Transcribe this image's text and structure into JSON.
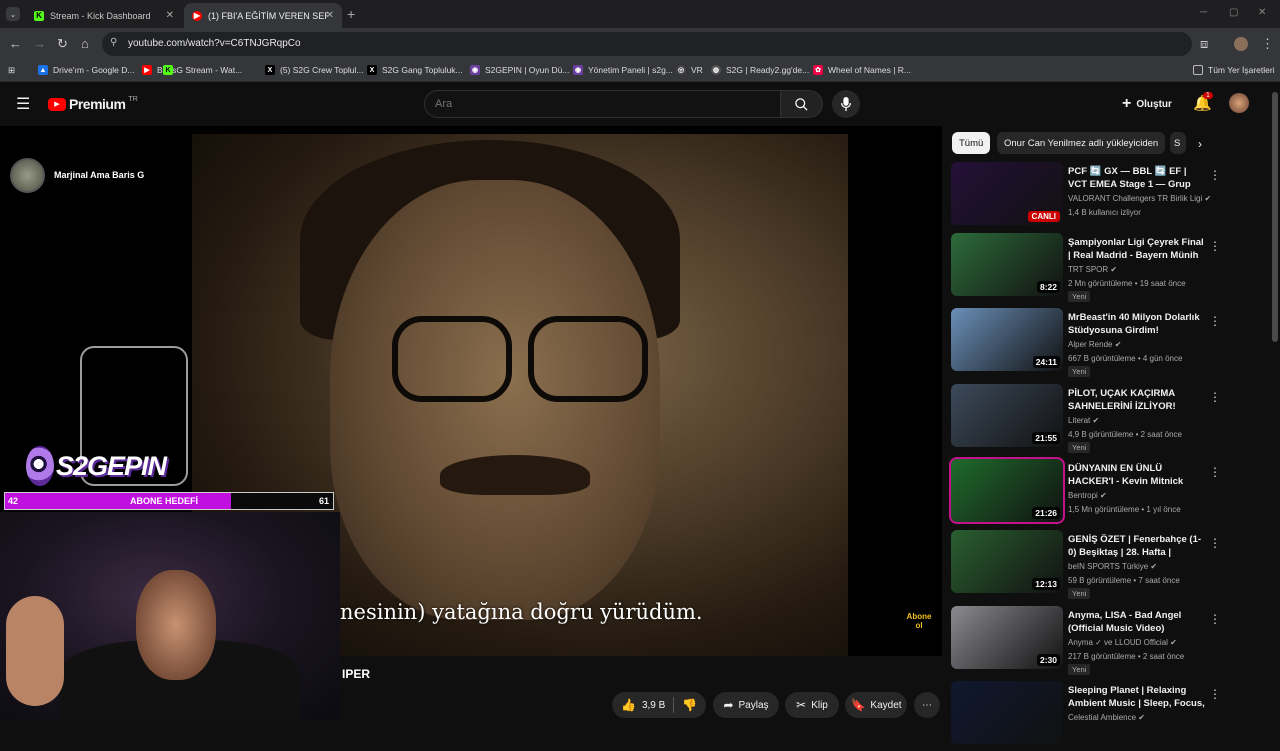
{
  "browser": {
    "tabs": [
      {
        "title": "Stream - Kick Dashboard",
        "icon": "kick-icon"
      },
      {
        "title": "(1) FBI'A EĞİTİM VEREN SERİ K…",
        "icon": "youtube-icon"
      }
    ],
    "url": "youtube.com/watch?v=C6TNJGRqpCo",
    "bookmarks": [
      "Drive'ım - Google D...",
      "BarisG Stream - Wat...",
      "(5) S2G Crew Toplul...",
      "S2G Gang Topluluk...",
      "S2GEPIN | Oyun Dü...",
      "Yönetim Paneli | s2g...",
      "VR",
      "S2G | Ready2.gg'de...",
      "Wheel of Names | R..."
    ],
    "all_bookmarks": "Tüm Yer İşaretleri"
  },
  "youtube": {
    "logo_text": "Premium",
    "logo_sup": "TR",
    "search_placeholder": "Ara",
    "create_label": "Oluştur",
    "notif_count": "1"
  },
  "overlay": {
    "channel_name": "Marjinal Ama Baris G",
    "logo_text": "S2GEPIN",
    "goal_current": "42",
    "goal_title": "ABONE HEDEFİ",
    "goal_target": "61",
    "goal_progress": 0.69
  },
  "video": {
    "subtitle": "nesinin) yatağına doğru yürüdüm.",
    "title_fragment": "IPER",
    "badge": "Abone ol",
    "actions": {
      "likes": "3,9 B",
      "share": "Paylaş",
      "clip": "Klip",
      "save": "Kaydet"
    }
  },
  "chips": [
    "Tümü",
    "Onur Can Yenilmez adlı yükleyiciden",
    "S"
  ],
  "recommendations": [
    {
      "title": "PCF 🔄 GX — BBL 🔄 EF | VCT EMEA Stage 1 — Grup Aşaması",
      "channel": "VALORANT Challengers TR Birlik Ligi",
      "meta": "1,4 B kullanıcı izliyor",
      "badge": "CANLI",
      "thumb_color": "#241038"
    },
    {
      "title": "Şampiyonlar Ligi Çeyrek Final | Real Madrid - Bayern Münih ...",
      "channel": "TRT SPOR",
      "meta": "2 Mn görüntüleme • 19 saat önce",
      "duration": "8:22",
      "tag": "Yeni",
      "thumb_color": "#2d6b3a"
    },
    {
      "title": "MrBeast'in 40 Milyon Dolarlık Stüdyosuna Girdim!",
      "channel": "Alper Rende",
      "meta": "667 B görüntüleme • 4 gün önce",
      "duration": "24:11",
      "tag": "Yeni",
      "thumb_color": "#6a8fb8"
    },
    {
      "title": "PİLOT, UÇAK KAÇIRMA SAHNELERİNİ İZLİYOR!",
      "channel": "Literat",
      "meta": "4,9 B görüntüleme • 2 saat önce",
      "duration": "21:55",
      "tag": "Yeni",
      "thumb_color": "#3c4a5a"
    },
    {
      "title": "DÜNYANIN EN ÜNLÜ HACKER'I - Kevin Mitnick",
      "channel": "Bentropi",
      "meta": "1,5 Mn görüntüleme • 1 yıl önce",
      "duration": "21:26",
      "thumb_color": "#1f6b2c"
    },
    {
      "title": "GENİŞ ÖZET | Fenerbahçe (1-0) Beşiktaş | 28. Hafta | Trendyol ...",
      "channel": "beIN SPORTS Türkiye",
      "meta": "59 B görüntüleme • 7 saat önce",
      "duration": "12:13",
      "tag": "Yeni",
      "thumb_color": "#2a5f30"
    },
    {
      "title": "Anyma, LISA - Bad Angel (Official Music Video)",
      "channel": "Anyma ✓ ve LLOUD Official",
      "meta": "217 B görüntüleme • 2 saat önce",
      "duration": "2:30",
      "tag": "Yeni",
      "thumb_color": "#8a8a90"
    },
    {
      "title": "Sleeping Planet | Relaxing Ambient Music | Sleep, Focus, ...",
      "channel": "Celestial Ambience",
      "meta": "",
      "thumb_color": "#101830"
    }
  ]
}
